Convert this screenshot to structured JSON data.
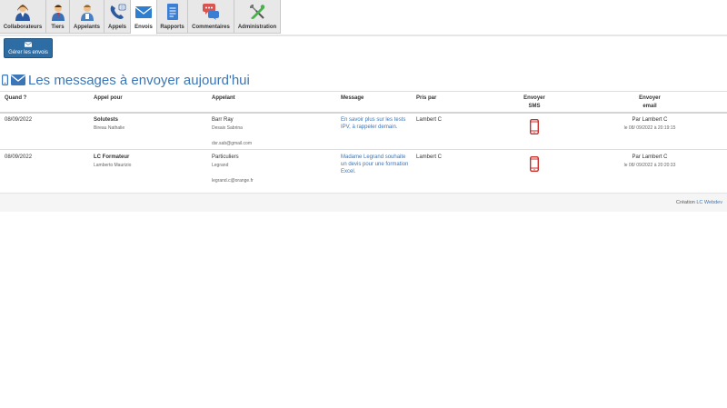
{
  "nav": {
    "tabs": [
      {
        "label": "Collaborateurs",
        "icon": "users-icon"
      },
      {
        "label": "Tiers",
        "icon": "person-icon"
      },
      {
        "label": "Appelants",
        "icon": "caller-icon"
      },
      {
        "label": "Appels",
        "icon": "phone-icon"
      },
      {
        "label": "Envois",
        "icon": "envelope-icon",
        "active": true
      },
      {
        "label": "Rapports",
        "icon": "document-icon"
      },
      {
        "label": "Commentaires",
        "icon": "comments-icon"
      },
      {
        "label": "Administration",
        "icon": "tools-icon"
      }
    ]
  },
  "toolbar": {
    "manage_label": "Gérer les envois"
  },
  "page": {
    "title": "Les messages à envoyer aujourd'hui"
  },
  "table": {
    "headers": {
      "quand": "Quand ?",
      "appel_pour": "Appel pour",
      "appelant": "Appelant",
      "message": "Message",
      "pris_par": "Pris par",
      "envoyer_sms_1": "Envoyer",
      "envoyer_sms_2": "SMS",
      "envoyer_email_1": "Envoyer",
      "envoyer_email_2": "email"
    },
    "rows": [
      {
        "quand": "08/09/2022",
        "appel_pour": "Solutests",
        "appel_pour_sub": "Bireau Nathalie",
        "appelant": "Barr Ray",
        "appelant_sub": "Desaix Sabrina",
        "appelant_email": "dsr.sab@gmail.com",
        "message_1": "En savoir plus sur les tests",
        "message_2": "IPV, à rappeler demain.",
        "pris_par": "Lambert C",
        "email_par": "Par Lambert C",
        "email_date": "le 08/ 09/2022 à 20:19:15"
      },
      {
        "quand": "08/09/2022",
        "appel_pour": "LC Formateur",
        "appel_pour_sub": "Lamberto Maurizio",
        "appelant": "Particuliers",
        "appelant_sub": "Legrand",
        "appelant_email": "legrand.c@orange.fr",
        "message_1": "Madame Legrand souhaite",
        "message_2": "un devis pour une formation",
        "message_3": "Excel.",
        "pris_par": "Lambert C",
        "email_par": "Par Lambert C",
        "email_date": "le 08/ 09/2022 à 20:20:33"
      }
    ]
  },
  "footer": {
    "prefix": "Création",
    "link": "LC Webdev"
  },
  "colors": {
    "accent": "#3a76b8",
    "button": "#2e6da4",
    "sms_icon": "#c9302c"
  }
}
